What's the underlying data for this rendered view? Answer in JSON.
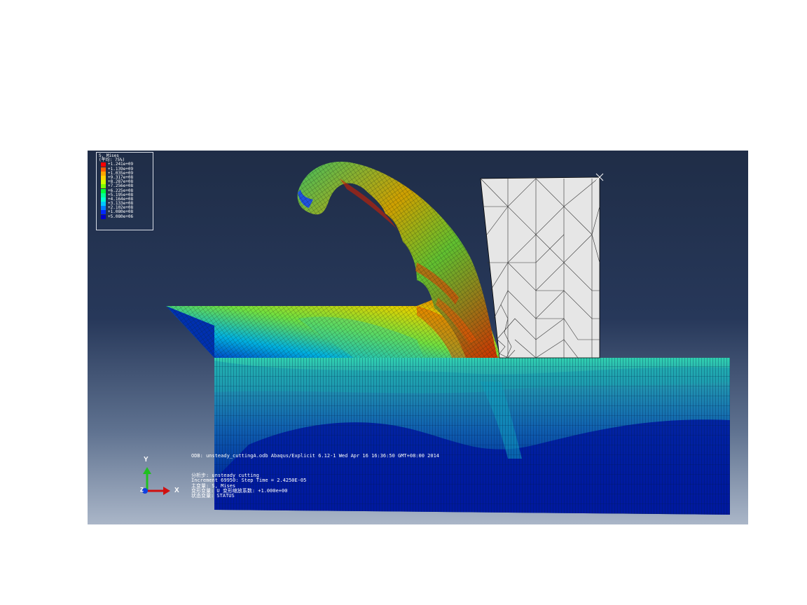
{
  "legend": {
    "title_line1": "S, Mises",
    "title_line2": "(平均: 75%)",
    "entries": [
      {
        "label": "+1.241e+09",
        "color": "#ff0000"
      },
      {
        "label": "+1.139e+09",
        "color": "#ff5a00"
      },
      {
        "label": "+1.035e+09",
        "color": "#ffa500"
      },
      {
        "label": "+9.317e+08",
        "color": "#ffd200"
      },
      {
        "label": "+8.287e+08",
        "color": "#d2ff00"
      },
      {
        "label": "+7.256e+08",
        "color": "#7dff00"
      },
      {
        "label": "+6.225e+08",
        "color": "#00ff3c"
      },
      {
        "label": "+5.195e+08",
        "color": "#00ff96"
      },
      {
        "label": "+4.164e+08",
        "color": "#00ffd2"
      },
      {
        "label": "+3.133e+08",
        "color": "#00c8ff"
      },
      {
        "label": "+2.102e+08",
        "color": "#007dff"
      },
      {
        "label": "+1.080e+08",
        "color": "#0028ff"
      },
      {
        "label": "+5.080e+06",
        "color": "#0000c8"
      }
    ]
  },
  "info": {
    "odb_line": "ODB: unsteady_cuttingA.odb    Abaqus/Explicit 6.12-1    Wed Apr 16 16:36:50 GMT+08:00 2014",
    "step_line": "分析步: unsteady cutting",
    "increment_line": "Increment    69950: Step Time =    2.4250E-05",
    "primary_var_line": "主变量: S, Mises",
    "deformed_var_line": "变形变量: U   变形缩放系数: +1.000e+00",
    "status_var_line": "状态变量: STATUS"
  },
  "triad": {
    "y_label": "Y",
    "x_label": "X",
    "z_label": "Z"
  },
  "colors": {
    "background_top": "#1f2d47",
    "background_bottom": "#aab6c8",
    "tool_fill": "#e6e6e6",
    "mesh_line": "#000000"
  }
}
